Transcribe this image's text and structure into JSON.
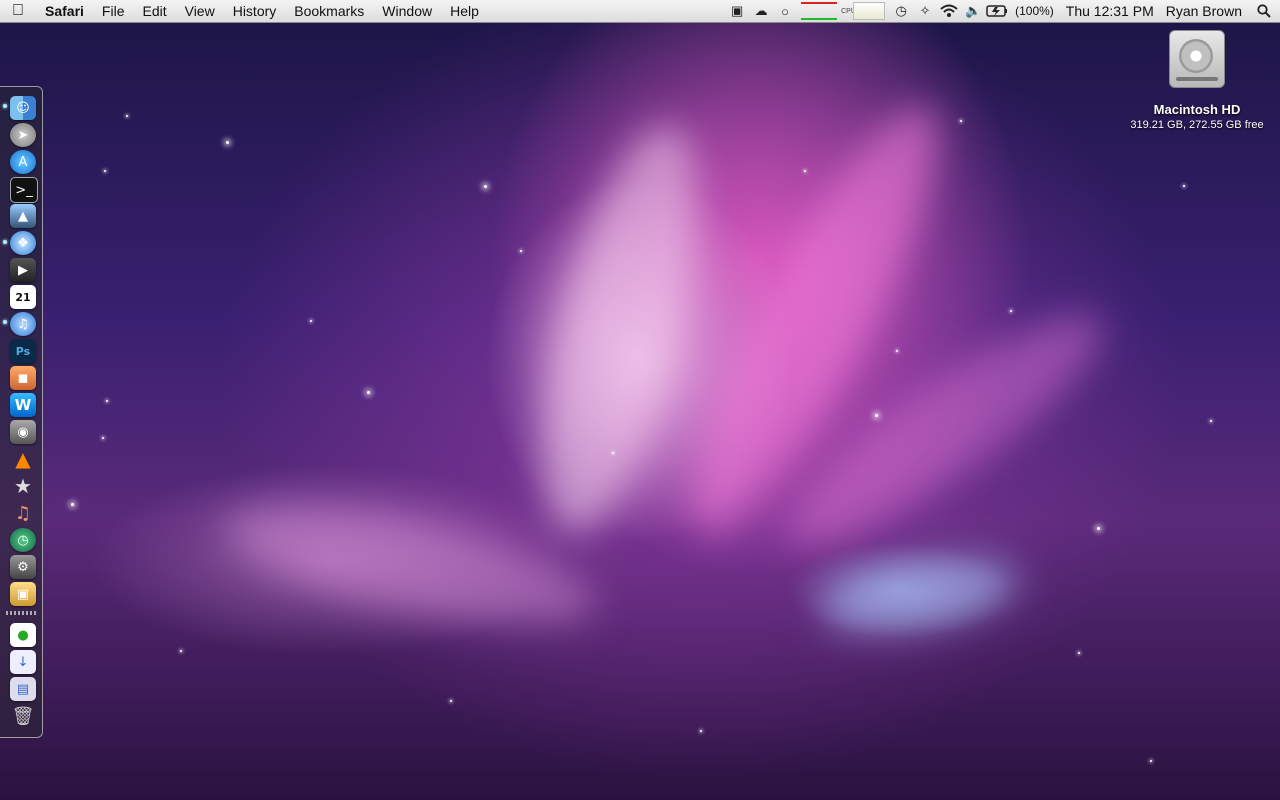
{
  "menubar": {
    "apple_icon": "apple-logo-icon",
    "app_name": "Safari",
    "menus": [
      "File",
      "Edit",
      "View",
      "History",
      "Bookmarks",
      "Window",
      "Help"
    ],
    "status_icons": [
      "airdisplay-icon",
      "cloud-icon",
      "chat-bubble-icon",
      "cpu-meter-icon",
      "memory-meter-icon",
      "time-machine-icon",
      "bluetooth-icon",
      "wifi-icon",
      "volume-icon",
      "battery-icon"
    ],
    "cpu_label": "CPU",
    "battery_percent": "(100%)",
    "clock": "Thu 12:31 PM",
    "user_name": "Ryan Brown",
    "spotlight_icon": "spotlight-search-icon"
  },
  "desktop": {
    "drive": {
      "icon": "hard-drive-icon",
      "name": "Macintosh HD",
      "info": "319.21 GB, 272.55 GB free"
    }
  },
  "dock": {
    "items": [
      {
        "icon": "finder-icon",
        "running": true
      },
      {
        "icon": "launchpad-rocket-icon",
        "running": false
      },
      {
        "icon": "app-store-icon",
        "running": false
      },
      {
        "icon": "terminal-icon",
        "running": false
      },
      {
        "icon": "preview-icon",
        "running": false
      },
      {
        "icon": "safari-icon",
        "running": true
      },
      {
        "icon": "facetime-icon",
        "running": false
      },
      {
        "icon": "calendar-icon",
        "label": "21",
        "running": false
      },
      {
        "icon": "itunes-icon",
        "running": true
      },
      {
        "icon": "photoshop-icon",
        "label": "Ps",
        "running": false
      },
      {
        "icon": "iphoto-icon",
        "running": false
      },
      {
        "icon": "word-icon",
        "label": "W",
        "running": false
      },
      {
        "icon": "disk-utility-icon",
        "running": false
      },
      {
        "icon": "vlc-icon",
        "running": false
      },
      {
        "icon": "imovie-icon",
        "running": false
      },
      {
        "icon": "garageband-icon",
        "running": false
      },
      {
        "icon": "time-machine-icon",
        "running": false
      },
      {
        "icon": "system-preferences-icon",
        "running": false
      },
      {
        "icon": "installer-icon",
        "running": false
      }
    ],
    "stack_items": [
      {
        "icon": "document-stack-icon"
      },
      {
        "icon": "downloads-stack-icon"
      },
      {
        "icon": "applications-stack-icon"
      },
      {
        "icon": "trash-icon"
      }
    ]
  }
}
